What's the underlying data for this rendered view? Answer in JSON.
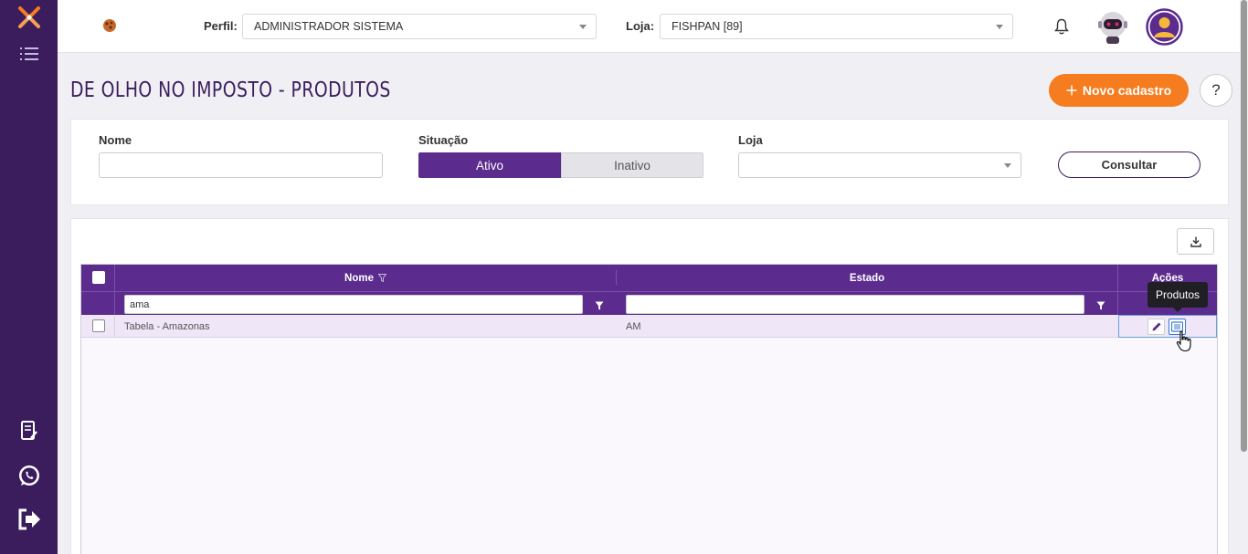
{
  "header": {
    "perfil_label": "Perfil",
    "perfil_value": "ADMINISTRADOR SISTEMA",
    "loja_label": "Loja",
    "loja_value": "FISHPAN [89]"
  },
  "page": {
    "title": "DE OLHO NO IMPOSTO - PRODUTOS",
    "new_button": "Novo cadastro",
    "help_button": "?"
  },
  "filters": {
    "nome_label": "Nome",
    "nome_value": "",
    "situacao_label": "Situação",
    "situacao_options": [
      "Ativo",
      "Inativo"
    ],
    "situacao_selected": "Ativo",
    "loja_label": "Loja",
    "loja_value": "",
    "consultar_button": "Consultar"
  },
  "grid": {
    "columns": [
      "Nome",
      "Estado",
      "Ações"
    ],
    "filter_nome": "ama",
    "filter_estado": "",
    "rows": [
      {
        "nome": "Tabela - Amazonas",
        "estado": "AM"
      }
    ],
    "tooltip": "Produtos"
  },
  "colors": {
    "sidebar": "#3b1d5e",
    "primary": "#5b2c8e",
    "accent": "#f57c1f"
  },
  "icons": {
    "sidebar_top": [
      "logo-icon",
      "menu-list-icon"
    ],
    "sidebar_bottom": [
      "document-edit-icon",
      "whatsapp-icon",
      "logout-icon"
    ],
    "header": [
      "store-icon",
      "bell-icon",
      "robot-avatar",
      "user-avatar"
    ]
  }
}
